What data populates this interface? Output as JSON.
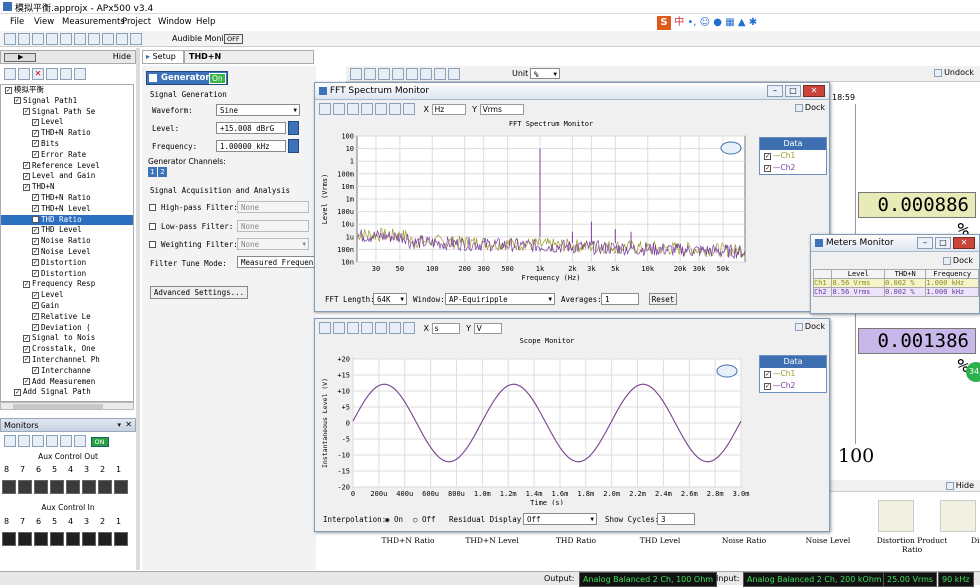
{
  "app": {
    "title": "模拟平衡.approjx - APx500 v3.4",
    "menu": [
      "File",
      "View",
      "Measurements",
      "Project",
      "Window",
      "Help"
    ],
    "audible_monitor": "Audible Monitor",
    "off_label": "OFF"
  },
  "nav": {
    "hide": "Hide",
    "setup": "Setup",
    "measurement": "THD+N"
  },
  "tree": [
    {
      "t": "模拟平衡",
      "d": 0
    },
    {
      "t": "Signal Path1",
      "d": 1
    },
    {
      "t": "Signal Path Se",
      "d": 2
    },
    {
      "t": "Level",
      "d": 3
    },
    {
      "t": "THD+N Ratio",
      "d": 3
    },
    {
      "t": "Bits",
      "d": 3
    },
    {
      "t": "Error Rate",
      "d": 3
    },
    {
      "t": "Reference Level",
      "d": 2
    },
    {
      "t": "Level and Gain",
      "d": 2
    },
    {
      "t": "THD+N",
      "d": 2
    },
    {
      "t": "THD+N Ratio",
      "d": 3
    },
    {
      "t": "THD+N Level",
      "d": 3
    },
    {
      "t": "THD Ratio",
      "d": 3,
      "sel": true
    },
    {
      "t": "THD Level",
      "d": 3
    },
    {
      "t": "Noise Ratio",
      "d": 3
    },
    {
      "t": "Noise Level",
      "d": 3
    },
    {
      "t": "Distortion",
      "d": 3
    },
    {
      "t": "Distortion",
      "d": 3
    },
    {
      "t": "Frequency Resp",
      "d": 2
    },
    {
      "t": "Level",
      "d": 3
    },
    {
      "t": "Gain",
      "d": 3
    },
    {
      "t": "Relative Le",
      "d": 3
    },
    {
      "t": "Deviation (",
      "d": 3
    },
    {
      "t": "Signal to Nois",
      "d": 2
    },
    {
      "t": "Crosstalk, One",
      "d": 2
    },
    {
      "t": "Interchannel Ph",
      "d": 2
    },
    {
      "t": "Interchanne",
      "d": 3
    },
    {
      "t": "Add Measuremen",
      "d": 2
    },
    {
      "t": "Add Signal Path",
      "d": 1
    }
  ],
  "monitors": {
    "title": "Monitors",
    "aux_out": "Aux Control Out",
    "aux_in": "Aux Control In",
    "bits": [
      "8",
      "7",
      "6",
      "5",
      "4",
      "3",
      "2",
      "1"
    ],
    "on": "ON"
  },
  "generator": {
    "title": "Generator",
    "on": "On",
    "signal_generation": "Signal Generation",
    "waveform_label": "Waveform:",
    "waveform": "Sine",
    "level_label": "Level:",
    "level": "+15.008 dBrG",
    "freq_label": "Frequency:",
    "freq": "1.00000 kHz",
    "channels_label": "Generator Channels:",
    "ch": [
      "1",
      "2"
    ]
  },
  "acq": {
    "title": "Signal Acquisition and Analysis",
    "hp": "High-pass Filter:",
    "lp": "Low-pass Filter:",
    "wt": "Weighting Filter:",
    "none": "None",
    "tune": "Filter Tune Mode:",
    "tune_val": "Measured Frequenc",
    "advanced": "Advanced Settings..."
  },
  "bg_toolbar": {
    "unit": "Unit",
    "unit_val": "%",
    "undock": "Undock",
    "time": "18:59"
  },
  "fft": {
    "title": "FFT Spectrum Monitor",
    "x_unit": "Hz",
    "y_unit": "Vrms",
    "dock": "Dock",
    "plot_title": "FFT Spectrum Monitor",
    "ylabel": "Level (Vrms)",
    "xlabel": "Frequency (Hz)",
    "yticks": [
      "100",
      "10",
      "1",
      "100m",
      "10m",
      "1m",
      "100u",
      "10u",
      "1u",
      "100n",
      "10n"
    ],
    "xticks": [
      "30",
      "50",
      "100",
      "200",
      "300",
      "500",
      "1k",
      "2k",
      "3k",
      "5k",
      "10k",
      "20k",
      "30k",
      "50k"
    ],
    "fft_length_label": "FFT Length:",
    "fft_length": "64K",
    "window_label": "Window:",
    "window": "AP-Equiripple",
    "averages_label": "Averages:",
    "averages": "1",
    "reset": "Reset"
  },
  "legend": {
    "title": "Data",
    "ch1": "Ch1",
    "ch2": "Ch2"
  },
  "scope": {
    "title": "Scope Monitor",
    "x_unit": "s",
    "y_unit": "V",
    "dock": "Dock",
    "ylabel": "Instantaneous Level (V)",
    "xlabel": "Time (s)",
    "yticks": [
      "+20",
      "+15",
      "+10",
      "+5",
      "0",
      "-5",
      "-10",
      "-15",
      "-20"
    ],
    "xticks": [
      "0",
      "200u",
      "400u",
      "600u",
      "800u",
      "1.0m",
      "1.2m",
      "1.4m",
      "1.6m",
      "1.8m",
      "2.0m",
      "2.2m",
      "2.4m",
      "2.6m",
      "2.8m",
      "3.0m"
    ],
    "interp_label": "Interpolation:",
    "on": "On",
    "off": "Off",
    "residual_label": "Residual Display:",
    "residual": "Off",
    "cycles_label": "Show Cycles:",
    "cycles": "3"
  },
  "meters": {
    "title": "Meters Monitor",
    "dock": "Dock",
    "headers": [
      "",
      "Level",
      "THD+N",
      "Frequency"
    ],
    "rows": [
      [
        "Ch1",
        "8.56 Vrms",
        "0.002 %",
        "1.000 kHz"
      ],
      [
        "Ch2",
        "8.56 Vrms",
        "0.002 %",
        "1.000 kHz"
      ]
    ]
  },
  "readouts": {
    "r1": "0.000886 %",
    "r2": "0.001386 %",
    "big": "100"
  },
  "bottom_tabs": [
    "THD+N Ratio",
    "THD+N Level",
    "THD Ratio",
    "THD Level",
    "Noise Ratio",
    "Noise Level",
    "Distortion Product Ratio",
    "Distortion Le"
  ],
  "status": {
    "output_label": "Output:",
    "output": "Analog Balanced 2 Ch, 100 Ohm",
    "input_label": "Input:",
    "input": "Analog Balanced 2 Ch, 200 kOhm",
    "level": "25.00 Vrms",
    "freq": "90 kHz"
  },
  "ime": {
    "items": [
      "S",
      "中",
      "•,",
      "☺",
      "🎤",
      "⌨",
      "👕",
      "⚙"
    ]
  },
  "colors": {
    "ch1": "#9c9a2a",
    "ch2": "#7a3ea8",
    "accent": "#3e6fb0",
    "meter_green": "#e8eab8",
    "meter_purple": "#c8b8ea"
  }
}
